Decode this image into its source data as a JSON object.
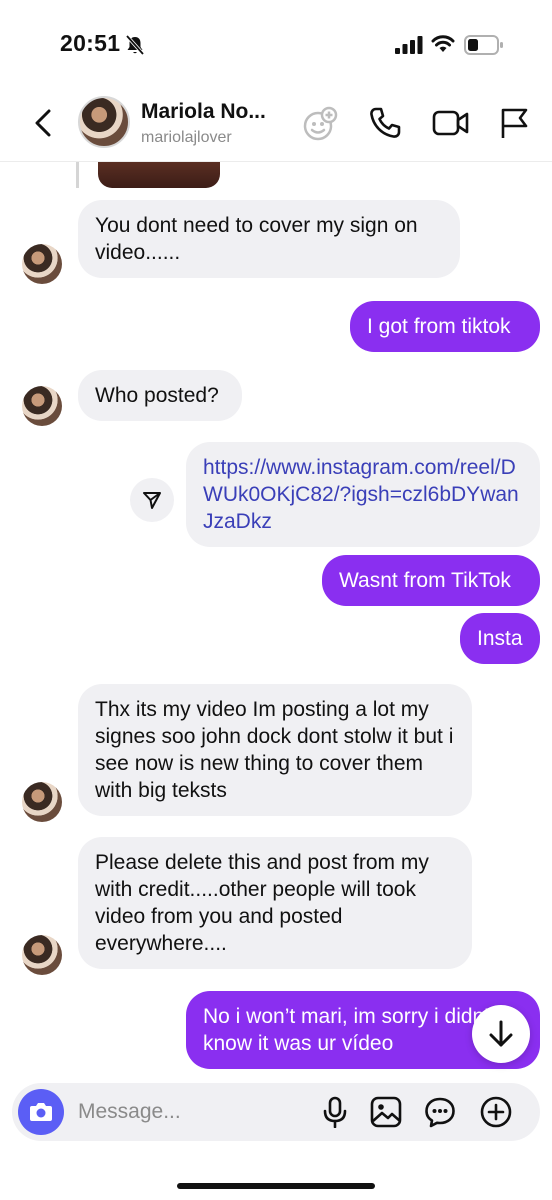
{
  "status_bar": {
    "time": "20:51"
  },
  "header": {
    "contact_name": "Mariola No...",
    "contact_username": "mariolajlover"
  },
  "messages": [
    {
      "direction": "incoming",
      "text": "You dont need to cover my sign on video......"
    },
    {
      "direction": "outgoing",
      "text": "I got from tiktok"
    },
    {
      "direction": "incoming",
      "text": "Who posted?"
    },
    {
      "direction": "outgoing",
      "type": "link",
      "text": "https://www.instagram.com/reel/DWUk0OKjC82/?igsh=czl6bDYwanJzaDkz"
    },
    {
      "direction": "outgoing",
      "text": "Wasnt from TikTok"
    },
    {
      "direction": "outgoing",
      "text": "Insta"
    },
    {
      "direction": "incoming",
      "text": "Thx its my video Im posting a lot my signes soo john dock dont stolw it but i see now is new thing to cover them with big teksts"
    },
    {
      "direction": "incoming",
      "text": "Please delete this and post from my with credit.....other people will took video from you and posted everywhere...."
    },
    {
      "direction": "outgoing",
      "text": "No i won’t mari, im sorry i didn’t know it was ur vídeo"
    }
  ],
  "composer": {
    "placeholder": "Message..."
  },
  "colors": {
    "outgoing_bubble": "#8a2ff0",
    "incoming_bubble": "#f0f0f3",
    "link_text": "#3a3fb8",
    "camera_button": "#5b5ef5"
  },
  "icons": [
    "bell-off-icon",
    "signal-icon",
    "wifi-icon",
    "battery-icon",
    "back-icon",
    "effects-icon",
    "phone-icon",
    "video-icon",
    "flag-icon",
    "share-icon",
    "arrow-down-icon",
    "camera-icon",
    "mic-icon",
    "image-icon",
    "sticker-icon",
    "plus-icon"
  ]
}
